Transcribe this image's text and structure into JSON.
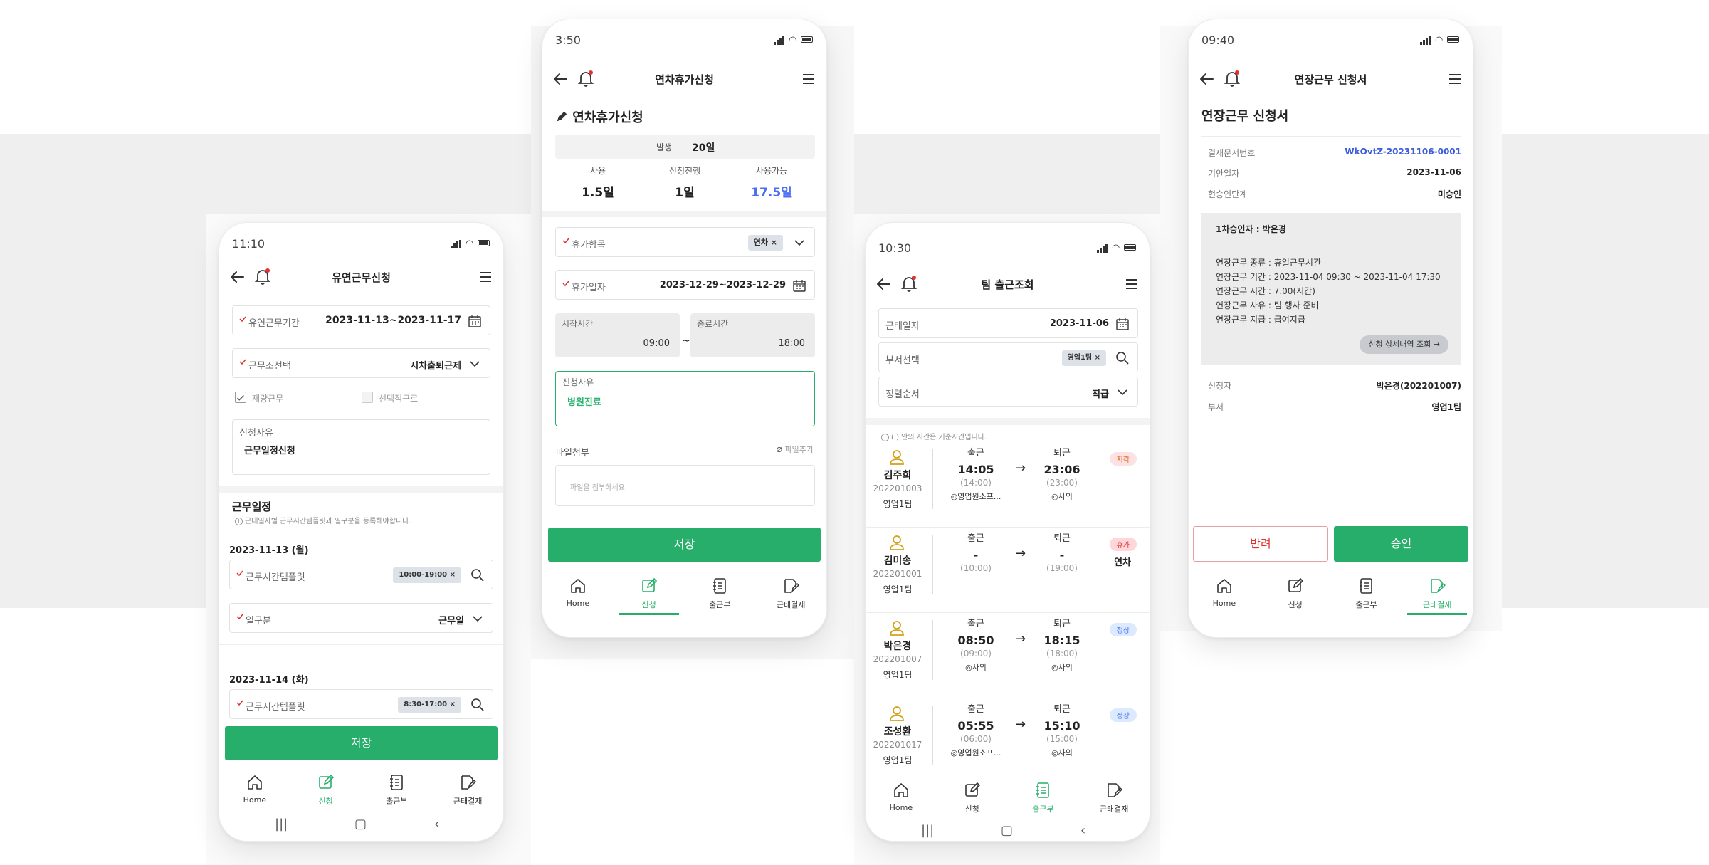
{
  "colors": {
    "accent": "#27ae6b",
    "link": "#3b5bdb",
    "danger": "#e03131",
    "late_bg": "#fde2e4",
    "leave_bg": "#ffd6d9",
    "normal_bg": "#dbeafe"
  },
  "phone1": {
    "status_time": "11:10",
    "title": "유연근무신청",
    "period_label": "유연근무기간",
    "period_value": "2023-11-13~2023-11-17",
    "type_label": "근무조선택",
    "type_value": "시차출퇴근제",
    "check1": "재량근무",
    "check2": "선택적근로",
    "reason_label": "신청사유",
    "reason_value": "근무일정신청",
    "schedule_title": "근무일정",
    "schedule_note": "근태일자별 근무시간템플릿과 일구분을 등록해야합니다.",
    "day1": "2023-11-13 (월)",
    "template_label": "근무시간템플릿",
    "day1_chip": "10:00-19:00",
    "daytype_label": "일구분",
    "daytype_value": "근무일",
    "day2": "2023-11-14 (화)",
    "day2_chip": "8:30-17:00",
    "save": "저장"
  },
  "phone2": {
    "status_time": "3:50",
    "title": "연차휴가신청",
    "heading": "연차휴가신청",
    "occur_label": "발생",
    "occur_value": "20일",
    "used_label": "사용",
    "used_value": "1.5일",
    "progress_label": "신청진행",
    "progress_value": "1일",
    "avail_label": "사용가능",
    "avail_value": "17.5일",
    "item_label": "휴가항목",
    "item_chip": "연차",
    "date_label": "휴가일자",
    "date_value": "2023-12-29~2023-12-29",
    "start_label": "시작시간",
    "start_value": "09:00",
    "tilde": "~",
    "end_label": "종료시간",
    "end_value": "18:00",
    "reason_label": "신청사유",
    "reason_value": "병원진료",
    "file_label": "파일첨부",
    "file_add": "파일추가",
    "file_placeholder": "파일을 첨부하세요",
    "save": "저장"
  },
  "phone3": {
    "status_time": "10:30",
    "title": "팀 출근조회",
    "date_label": "근태일자",
    "date_value": "2023-11-06",
    "dept_label": "부서선택",
    "dept_chip": "영업1팀",
    "sort_label": "정렬순서",
    "sort_value": "직급",
    "note": "( ) 안의 시간은 기준시간입니다.",
    "in_label": "출근",
    "out_label": "퇴근",
    "rows": [
      {
        "name": "김주희",
        "num": "202201003",
        "dept": "영업1팀",
        "in": "14:05",
        "in_std": "(14:00)",
        "in_place": "영업원소프...",
        "out": "23:06",
        "out_std": "(23:00)",
        "out_place": "사외",
        "badge": "지각",
        "extra": ""
      },
      {
        "name": "김미송",
        "num": "202201001",
        "dept": "영업1팀",
        "in": "-",
        "in_std": "(10:00)",
        "in_place": "",
        "out": "-",
        "out_std": "(19:00)",
        "out_place": "",
        "badge": "휴가",
        "extra": "연차"
      },
      {
        "name": "박은경",
        "num": "202201007",
        "dept": "영업1팀",
        "in": "08:50",
        "in_std": "(09:00)",
        "in_place": "사외",
        "out": "18:15",
        "out_std": "(18:00)",
        "out_place": "사외",
        "badge": "정상",
        "extra": ""
      },
      {
        "name": "조성환",
        "num": "202201017",
        "dept": "영업1팀",
        "in": "05:55",
        "in_std": "(06:00)",
        "in_place": "영업원소프...",
        "out": "15:10",
        "out_std": "(15:00)",
        "out_place": "사외",
        "badge": "정상",
        "extra": ""
      }
    ]
  },
  "phone4": {
    "status_time": "09:40",
    "title": "연장근무 신청서",
    "heading": "연장근무 신청서",
    "doc_label": "결재문서번호",
    "doc_value": "WkOvtZ-20231106-0001",
    "draft_label": "기안일자",
    "draft_value": "2023-11-06",
    "stage_label": "현승인단계",
    "stage_value": "미승인",
    "approver": "1차승인자 : 박은경",
    "detail_lines": [
      "연장근무 종류 : 휴일근무시간",
      "연장근무 기간 : 2023-11-04 09:30 ~ 2023-11-04 17:30",
      "연장근무 시간 : 7.00(시간)",
      "연장근무 사유 : 팀 행사 준비",
      "연장근무 지급 : 급여지급"
    ],
    "detail_btn": "신청 상세내역 조회 →",
    "applicant_label": "신청자",
    "applicant_value": "박은경(202201007)",
    "dept_label": "부서",
    "dept_value": "영업1팀",
    "reject": "반려",
    "approve": "승인"
  },
  "tabs": {
    "home": "Home",
    "apply": "신청",
    "attend": "출근부",
    "approve": "근태결재"
  }
}
